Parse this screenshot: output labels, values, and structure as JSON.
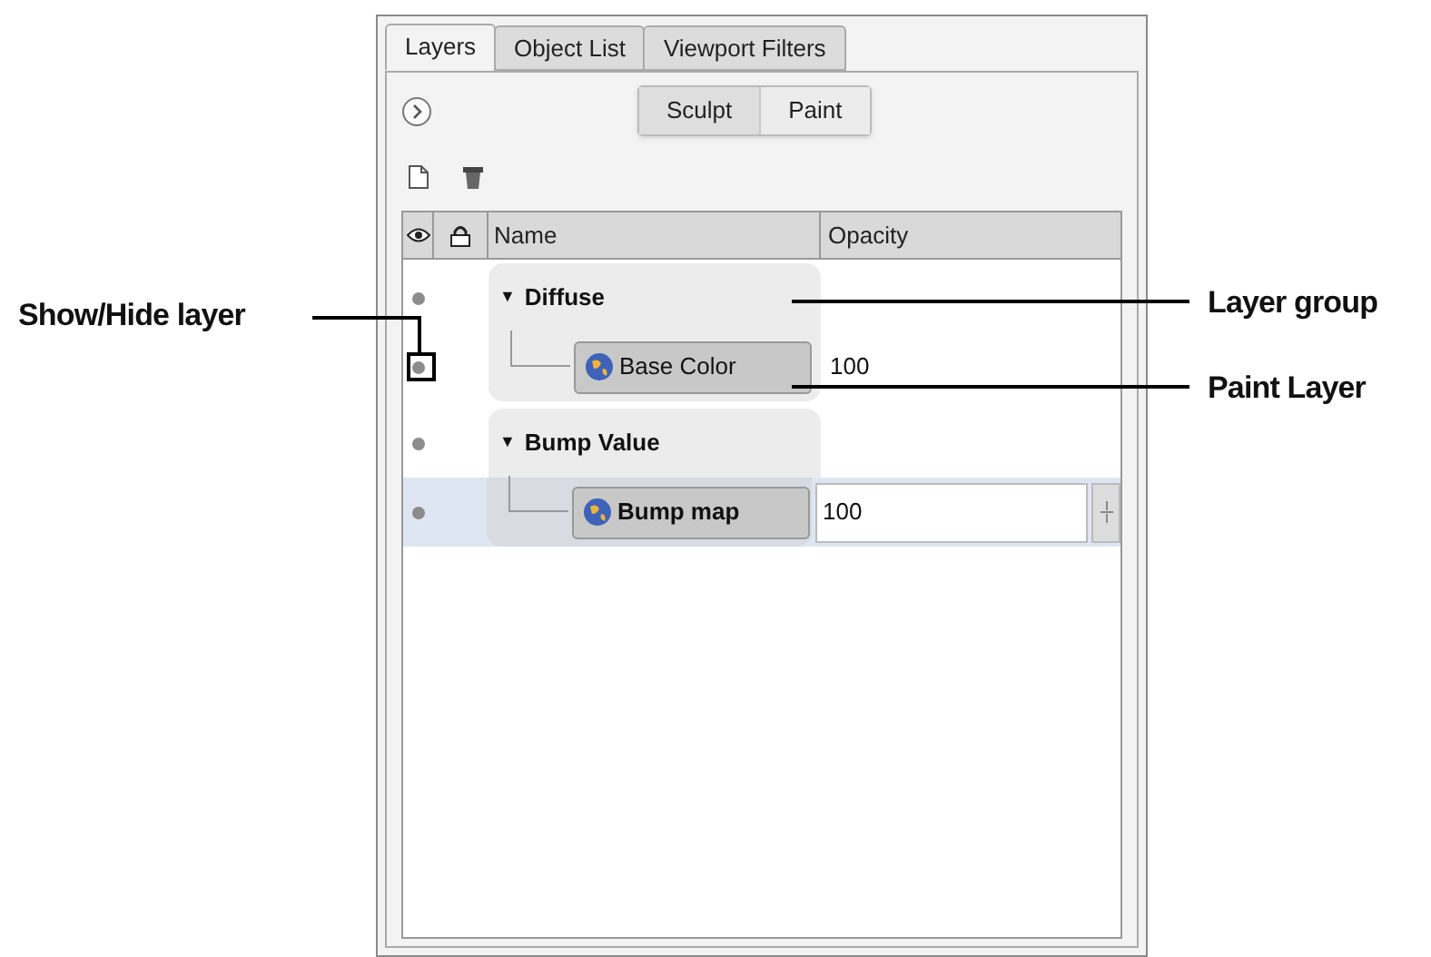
{
  "tabs": [
    {
      "label": "Layers",
      "selected": true
    },
    {
      "label": "Object List",
      "selected": false
    },
    {
      "label": "Viewport Filters",
      "selected": false
    }
  ],
  "mode_toggle": [
    {
      "label": "Sculpt",
      "selected": false
    },
    {
      "label": "Paint",
      "selected": true
    }
  ],
  "table": {
    "columns": [
      "Name",
      "Opacity"
    ],
    "groups": [
      {
        "name": "Diffuse",
        "expander": "▼",
        "expanded": true,
        "visible": true,
        "children": [
          {
            "name": "Base Color",
            "opacity": "100",
            "visible": true,
            "selected": false
          }
        ]
      },
      {
        "name": "Bump Value",
        "expander": "▼",
        "expanded": true,
        "visible": true,
        "children": [
          {
            "name": "Bump map",
            "opacity": "100",
            "visible": true,
            "selected": true
          }
        ]
      }
    ]
  },
  "callouts": [
    {
      "text": "Show/Hide layer",
      "kind": "left"
    },
    {
      "text": "Layer group",
      "kind": "right"
    },
    {
      "text": "Paint Layer",
      "kind": "right"
    }
  ]
}
